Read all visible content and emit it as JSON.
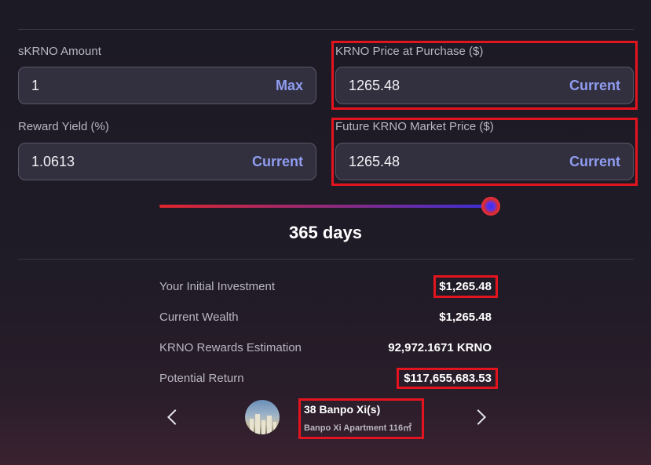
{
  "inputs": {
    "skrno_amount": {
      "label": "sKRNO Amount",
      "value": "1",
      "action": "Max"
    },
    "price_at_purchase": {
      "label": "KRNO Price at Purchase ($)",
      "value": "1265.48",
      "action": "Current"
    },
    "reward_yield": {
      "label": "Reward Yield (%)",
      "value": "1.0613",
      "action": "Current"
    },
    "future_price": {
      "label": "Future KRNO Market Price ($)",
      "value": "1265.48",
      "action": "Current"
    }
  },
  "slider": {
    "days_label": "365 days",
    "level": 1.0
  },
  "results": [
    {
      "label": "Your Initial Investment",
      "value": "$1,265.48"
    },
    {
      "label": "Current Wealth",
      "value": "$1,265.48"
    },
    {
      "label": "KRNO Rewards Estimation",
      "value": "92,972.1671 KRNO"
    },
    {
      "label": "Potential Return",
      "value": "$117,655,683.53"
    }
  ],
  "property": {
    "title": "38 Banpo Xi(s)",
    "subtitle": "Banpo Xi Apartment 116㎡"
  },
  "icons": {
    "prev": "chevron-left-icon",
    "next": "chevron-right-icon"
  },
  "colors": {
    "accent": "#8f9cf0",
    "highlight": "#e4141e",
    "slider_start": "#e0262e",
    "slider_end": "#3b2fd6"
  }
}
